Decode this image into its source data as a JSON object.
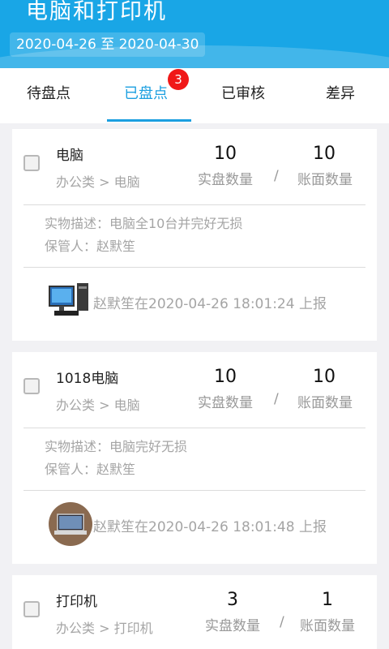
{
  "header": {
    "title": "电脑和打印机",
    "date_range": "2020-04-26 至 2020-04-30"
  },
  "tabs": [
    {
      "label": "待盘点"
    },
    {
      "label": "已盘点",
      "badge": "3"
    },
    {
      "label": "已审核"
    },
    {
      "label": "差异"
    }
  ],
  "items": [
    {
      "name": "电脑",
      "category": "办公类 > 电脑",
      "actual_count": "10",
      "actual_label": "实盘数量",
      "slash": "/",
      "book_count": "10",
      "book_label": "账面数量",
      "description": "实物描述：电脑全10台并完好无损",
      "custodian": "保管人：赵默笙",
      "report": "赵默笙在2020-04-26 18:01:24 上报"
    },
    {
      "name": "1018电脑",
      "category": "办公类 > 电脑",
      "actual_count": "10",
      "actual_label": "实盘数量",
      "slash": "/",
      "book_count": "10",
      "book_label": "账面数量",
      "description": "实物描述：电脑完好无损",
      "custodian": "保管人：赵默笙",
      "report": "赵默笙在2020-04-26 18:01:48 上报"
    },
    {
      "name": "打印机",
      "category": "办公类 > 打印机",
      "actual_count": "3",
      "actual_label": "实盘数量",
      "slash": "/",
      "book_count": "1",
      "book_label": "账面数量"
    }
  ],
  "colors": {
    "header_bg": "#19a6e6",
    "active_tab": "#1b9fe0",
    "badge": "#f01818"
  }
}
